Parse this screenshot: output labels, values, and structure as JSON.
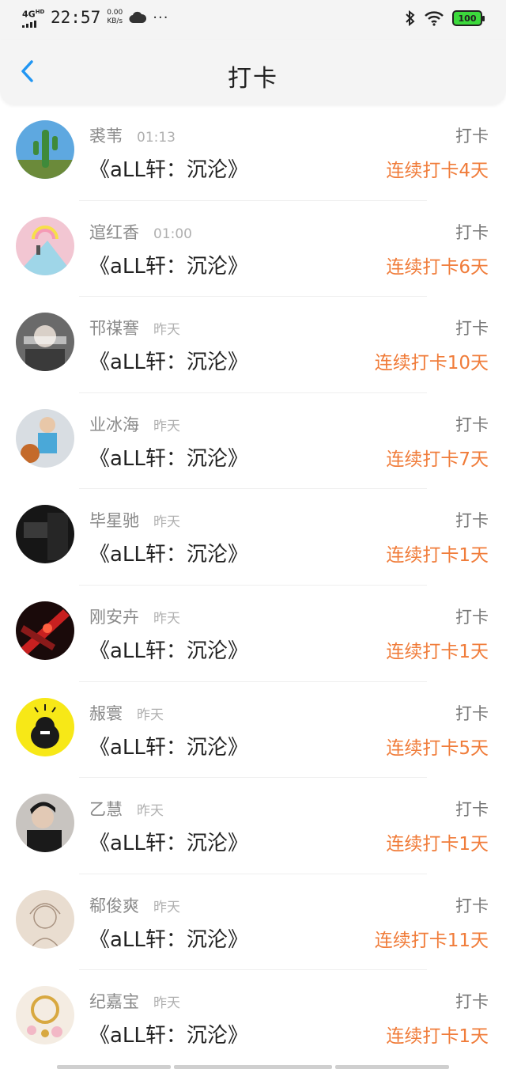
{
  "status_bar": {
    "network": "4G",
    "network_sup": "HD",
    "time": "22:57",
    "speed_value": "0.00",
    "speed_unit": "KB/s",
    "more": "···",
    "battery": "100"
  },
  "header": {
    "title": "打卡"
  },
  "entries": [
    {
      "name": "裘苇",
      "time": "01:13",
      "book": "《aLL轩：沉沦》",
      "action": "打卡",
      "streak": "连续打卡4天"
    },
    {
      "name": "逭红香",
      "time": "01:00",
      "book": "《aLL轩：沉沦》",
      "action": "打卡",
      "streak": "连续打卡6天"
    },
    {
      "name": "邗禖謇",
      "time": "昨天",
      "book": "《aLL轩：沉沦》",
      "action": "打卡",
      "streak": "连续打卡10天"
    },
    {
      "name": "业冰海",
      "time": "昨天",
      "book": "《aLL轩：沉沦》",
      "action": "打卡",
      "streak": "连续打卡7天"
    },
    {
      "name": "毕星驰",
      "time": "昨天",
      "book": "《aLL轩：沉沦》",
      "action": "打卡",
      "streak": "连续打卡1天"
    },
    {
      "name": "刚安卉",
      "time": "昨天",
      "book": "《aLL轩：沉沦》",
      "action": "打卡",
      "streak": "连续打卡1天"
    },
    {
      "name": "赧寰",
      "time": "昨天",
      "book": "《aLL轩：沉沦》",
      "action": "打卡",
      "streak": "连续打卡5天"
    },
    {
      "name": "乙慧",
      "time": "昨天",
      "book": "《aLL轩：沉沦》",
      "action": "打卡",
      "streak": "连续打卡1天"
    },
    {
      "name": "郗俊爽",
      "time": "昨天",
      "book": "《aLL轩：沉沦》",
      "action": "打卡",
      "streak": "连续打卡11天"
    },
    {
      "name": "纪嘉宝",
      "time": "昨天",
      "book": "《aLL轩：沉沦》",
      "action": "打卡",
      "streak": "连续打卡1天"
    }
  ],
  "colors": {
    "accent": "#2196f3",
    "streak": "#f07c3a",
    "battery": "#3cd93c"
  }
}
